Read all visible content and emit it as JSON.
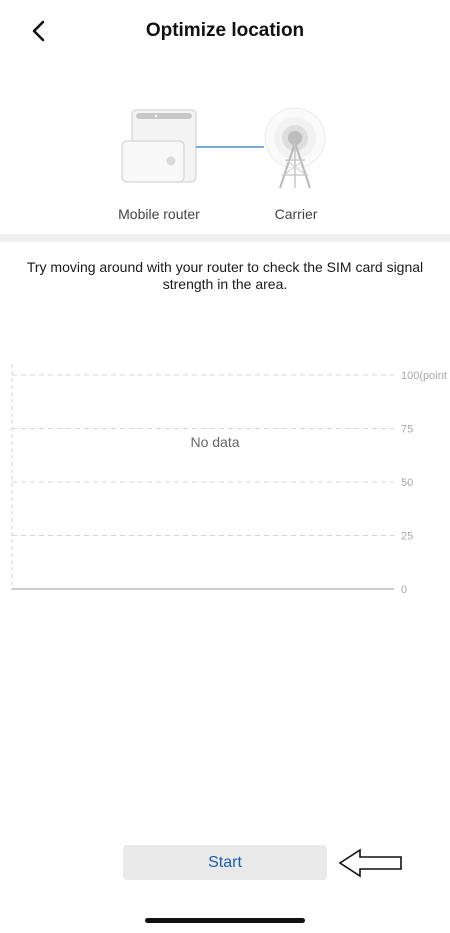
{
  "header": {
    "title": "Optimize location",
    "back_icon": "chevron-left-icon"
  },
  "topology": {
    "router_label": "Mobile router",
    "carrier_label": "Carrier",
    "link_color": "#4a90d9",
    "router_icon": "mobile-router-icon",
    "carrier_icon": "cell-tower-icon"
  },
  "instructions": {
    "text": "Try moving around with your router to check the SIM card signal strength in the area."
  },
  "chart_data": {
    "type": "line",
    "series": [],
    "empty_message": "No data",
    "y_tick_labels": [
      "100(point",
      "75",
      "50",
      "25",
      "0"
    ],
    "y_ticks": [
      100,
      75,
      50,
      25,
      0
    ],
    "ylim": [
      0,
      100
    ],
    "grid": true,
    "legend": "none"
  },
  "footer": {
    "start_label": "Start"
  },
  "annotation": {
    "arrow_icon": "pointer-arrow-icon"
  }
}
